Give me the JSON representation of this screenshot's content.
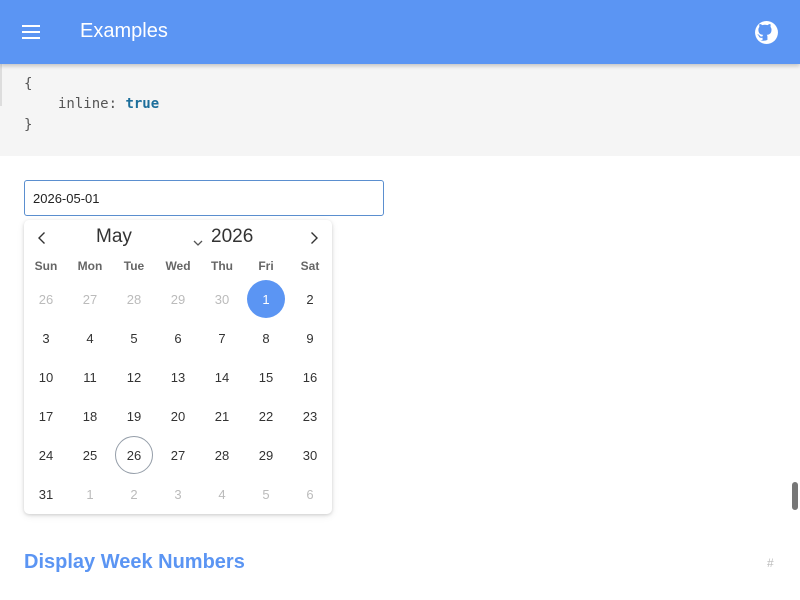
{
  "app": {
    "title": "Examples",
    "colors": {
      "primary": "#5b95f3",
      "link": "#5b95f3"
    }
  },
  "topbar": {
    "menu_icon": "hamburger-menu-icon",
    "github_icon": "github-icon"
  },
  "code": {
    "open_brace": "{",
    "key": "inline",
    "colon": ": ",
    "value": "true",
    "close_brace": "}"
  },
  "date_input": {
    "value": "2026-05-01"
  },
  "calendar": {
    "month": "May",
    "year": "2026",
    "prev_icon": "chevron-left-icon",
    "next_icon": "chevron-right-icon",
    "month_dropdown_icon": "chevron-down-icon",
    "weekdays": [
      "Sun",
      "Mon",
      "Tue",
      "Wed",
      "Thu",
      "Fri",
      "Sat"
    ],
    "weeks": [
      [
        "26",
        "27",
        "28",
        "29",
        "30",
        "1",
        "2"
      ],
      [
        "3",
        "4",
        "5",
        "6",
        "7",
        "8",
        "9"
      ],
      [
        "10",
        "11",
        "12",
        "13",
        "14",
        "15",
        "16"
      ],
      [
        "17",
        "18",
        "19",
        "20",
        "21",
        "22",
        "23"
      ],
      [
        "24",
        "25",
        "26",
        "27",
        "28",
        "29",
        "30"
      ],
      [
        "31",
        "1",
        "2",
        "3",
        "4",
        "5",
        "6"
      ]
    ],
    "selected_day": "1",
    "today_day": "26"
  },
  "section": {
    "title": "Display Week Numbers",
    "anchor": "#"
  }
}
